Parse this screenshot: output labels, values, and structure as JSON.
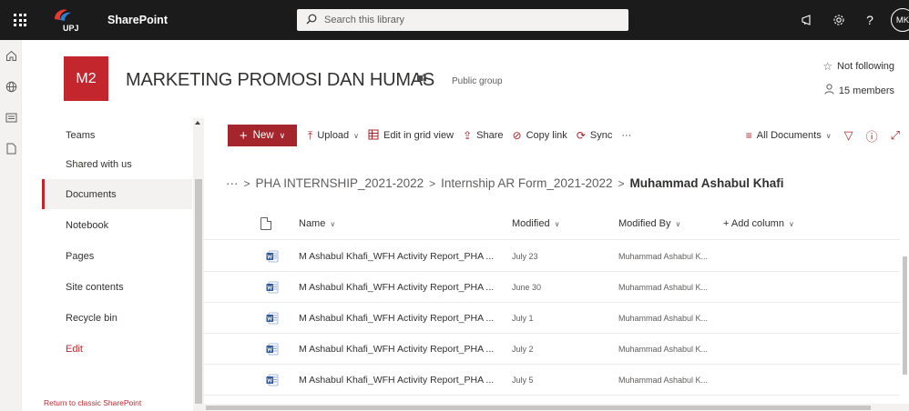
{
  "suite": {
    "app_name": "SharePoint",
    "logo_text": "UPJ",
    "search_placeholder": "Search this library",
    "avatar_initials": "MK",
    "help_label": "?"
  },
  "site": {
    "logo_text": "M2",
    "title": "MARKETING PROMOSI DAN HUMAS",
    "group_label": "Public group",
    "follow_label": "Not following",
    "members_label": "15 members"
  },
  "nav": {
    "items": [
      {
        "label": "Teams"
      },
      {
        "label": "Shared with us"
      },
      {
        "label": "Documents"
      },
      {
        "label": "Notebook"
      },
      {
        "label": "Pages"
      },
      {
        "label": "Site contents"
      },
      {
        "label": "Recycle bin"
      },
      {
        "label": "Edit"
      }
    ],
    "classic_link": "Return to classic SharePoint"
  },
  "command_bar": {
    "new_label": "New",
    "upload_label": "Upload",
    "grid_label": "Edit in grid view",
    "share_label": "Share",
    "copy_link_label": "Copy link",
    "sync_label": "Sync",
    "more_label": "···",
    "view_label": "All Documents"
  },
  "breadcrumb": {
    "ellipsis": "···",
    "items": [
      "PHA INTERNSHIP_2021-2022",
      "Internship AR Form_2021-2022"
    ],
    "current": "Muhammad Ashabul Khafi"
  },
  "list": {
    "columns": {
      "name": "Name",
      "modified": "Modified",
      "modified_by": "Modified By",
      "add_column": "+ Add column"
    },
    "rows": [
      {
        "name": "M Ashabul Khafi_WFH Activity Report_PHA ...",
        "modified": "July 23",
        "modified_by": "Muhammad Ashabul K..."
      },
      {
        "name": "M Ashabul Khafi_WFH Activity Report_PHA ...",
        "modified": "June 30",
        "modified_by": "Muhammad Ashabul K..."
      },
      {
        "name": "M Ashabul Khafi_WFH Activity Report_PHA ...",
        "modified": "July 1",
        "modified_by": "Muhammad Ashabul K..."
      },
      {
        "name": "M Ashabul Khafi_WFH Activity Report_PHA ...",
        "modified": "July 2",
        "modified_by": "Muhammad Ashabul K..."
      },
      {
        "name": "M Ashabul Khafi_WFH Activity Report_PHA ...",
        "modified": "July 5",
        "modified_by": "Muhammad Ashabul K..."
      }
    ]
  },
  "colors": {
    "accent": "#c4262e",
    "suite_bar": "#1b1b1b",
    "word_icon": "#2b579a"
  }
}
